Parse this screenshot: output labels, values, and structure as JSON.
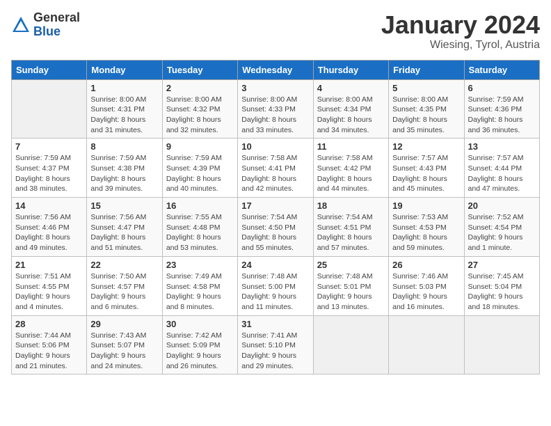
{
  "header": {
    "logo_general": "General",
    "logo_blue": "Blue",
    "month_title": "January 2024",
    "subtitle": "Wiesing, Tyrol, Austria"
  },
  "days_of_week": [
    "Sunday",
    "Monday",
    "Tuesday",
    "Wednesday",
    "Thursday",
    "Friday",
    "Saturday"
  ],
  "weeks": [
    [
      {
        "day": "",
        "sunrise": "",
        "sunset": "",
        "daylight": ""
      },
      {
        "day": "1",
        "sunrise": "Sunrise: 8:00 AM",
        "sunset": "Sunset: 4:31 PM",
        "daylight": "Daylight: 8 hours and 31 minutes."
      },
      {
        "day": "2",
        "sunrise": "Sunrise: 8:00 AM",
        "sunset": "Sunset: 4:32 PM",
        "daylight": "Daylight: 8 hours and 32 minutes."
      },
      {
        "day": "3",
        "sunrise": "Sunrise: 8:00 AM",
        "sunset": "Sunset: 4:33 PM",
        "daylight": "Daylight: 8 hours and 33 minutes."
      },
      {
        "day": "4",
        "sunrise": "Sunrise: 8:00 AM",
        "sunset": "Sunset: 4:34 PM",
        "daylight": "Daylight: 8 hours and 34 minutes."
      },
      {
        "day": "5",
        "sunrise": "Sunrise: 8:00 AM",
        "sunset": "Sunset: 4:35 PM",
        "daylight": "Daylight: 8 hours and 35 minutes."
      },
      {
        "day": "6",
        "sunrise": "Sunrise: 7:59 AM",
        "sunset": "Sunset: 4:36 PM",
        "daylight": "Daylight: 8 hours and 36 minutes."
      }
    ],
    [
      {
        "day": "7",
        "sunrise": "Sunrise: 7:59 AM",
        "sunset": "Sunset: 4:37 PM",
        "daylight": "Daylight: 8 hours and 38 minutes."
      },
      {
        "day": "8",
        "sunrise": "Sunrise: 7:59 AM",
        "sunset": "Sunset: 4:38 PM",
        "daylight": "Daylight: 8 hours and 39 minutes."
      },
      {
        "day": "9",
        "sunrise": "Sunrise: 7:59 AM",
        "sunset": "Sunset: 4:39 PM",
        "daylight": "Daylight: 8 hours and 40 minutes."
      },
      {
        "day": "10",
        "sunrise": "Sunrise: 7:58 AM",
        "sunset": "Sunset: 4:41 PM",
        "daylight": "Daylight: 8 hours and 42 minutes."
      },
      {
        "day": "11",
        "sunrise": "Sunrise: 7:58 AM",
        "sunset": "Sunset: 4:42 PM",
        "daylight": "Daylight: 8 hours and 44 minutes."
      },
      {
        "day": "12",
        "sunrise": "Sunrise: 7:57 AM",
        "sunset": "Sunset: 4:43 PM",
        "daylight": "Daylight: 8 hours and 45 minutes."
      },
      {
        "day": "13",
        "sunrise": "Sunrise: 7:57 AM",
        "sunset": "Sunset: 4:44 PM",
        "daylight": "Daylight: 8 hours and 47 minutes."
      }
    ],
    [
      {
        "day": "14",
        "sunrise": "Sunrise: 7:56 AM",
        "sunset": "Sunset: 4:46 PM",
        "daylight": "Daylight: 8 hours and 49 minutes."
      },
      {
        "day": "15",
        "sunrise": "Sunrise: 7:56 AM",
        "sunset": "Sunset: 4:47 PM",
        "daylight": "Daylight: 8 hours and 51 minutes."
      },
      {
        "day": "16",
        "sunrise": "Sunrise: 7:55 AM",
        "sunset": "Sunset: 4:48 PM",
        "daylight": "Daylight: 8 hours and 53 minutes."
      },
      {
        "day": "17",
        "sunrise": "Sunrise: 7:54 AM",
        "sunset": "Sunset: 4:50 PM",
        "daylight": "Daylight: 8 hours and 55 minutes."
      },
      {
        "day": "18",
        "sunrise": "Sunrise: 7:54 AM",
        "sunset": "Sunset: 4:51 PM",
        "daylight": "Daylight: 8 hours and 57 minutes."
      },
      {
        "day": "19",
        "sunrise": "Sunrise: 7:53 AM",
        "sunset": "Sunset: 4:53 PM",
        "daylight": "Daylight: 8 hours and 59 minutes."
      },
      {
        "day": "20",
        "sunrise": "Sunrise: 7:52 AM",
        "sunset": "Sunset: 4:54 PM",
        "daylight": "Daylight: 9 hours and 1 minute."
      }
    ],
    [
      {
        "day": "21",
        "sunrise": "Sunrise: 7:51 AM",
        "sunset": "Sunset: 4:55 PM",
        "daylight": "Daylight: 9 hours and 4 minutes."
      },
      {
        "day": "22",
        "sunrise": "Sunrise: 7:50 AM",
        "sunset": "Sunset: 4:57 PM",
        "daylight": "Daylight: 9 hours and 6 minutes."
      },
      {
        "day": "23",
        "sunrise": "Sunrise: 7:49 AM",
        "sunset": "Sunset: 4:58 PM",
        "daylight": "Daylight: 9 hours and 8 minutes."
      },
      {
        "day": "24",
        "sunrise": "Sunrise: 7:48 AM",
        "sunset": "Sunset: 5:00 PM",
        "daylight": "Daylight: 9 hours and 11 minutes."
      },
      {
        "day": "25",
        "sunrise": "Sunrise: 7:48 AM",
        "sunset": "Sunset: 5:01 PM",
        "daylight": "Daylight: 9 hours and 13 minutes."
      },
      {
        "day": "26",
        "sunrise": "Sunrise: 7:46 AM",
        "sunset": "Sunset: 5:03 PM",
        "daylight": "Daylight: 9 hours and 16 minutes."
      },
      {
        "day": "27",
        "sunrise": "Sunrise: 7:45 AM",
        "sunset": "Sunset: 5:04 PM",
        "daylight": "Daylight: 9 hours and 18 minutes."
      }
    ],
    [
      {
        "day": "28",
        "sunrise": "Sunrise: 7:44 AM",
        "sunset": "Sunset: 5:06 PM",
        "daylight": "Daylight: 9 hours and 21 minutes."
      },
      {
        "day": "29",
        "sunrise": "Sunrise: 7:43 AM",
        "sunset": "Sunset: 5:07 PM",
        "daylight": "Daylight: 9 hours and 24 minutes."
      },
      {
        "day": "30",
        "sunrise": "Sunrise: 7:42 AM",
        "sunset": "Sunset: 5:09 PM",
        "daylight": "Daylight: 9 hours and 26 minutes."
      },
      {
        "day": "31",
        "sunrise": "Sunrise: 7:41 AM",
        "sunset": "Sunset: 5:10 PM",
        "daylight": "Daylight: 9 hours and 29 minutes."
      },
      {
        "day": "",
        "sunrise": "",
        "sunset": "",
        "daylight": ""
      },
      {
        "day": "",
        "sunrise": "",
        "sunset": "",
        "daylight": ""
      },
      {
        "day": "",
        "sunrise": "",
        "sunset": "",
        "daylight": ""
      }
    ]
  ]
}
